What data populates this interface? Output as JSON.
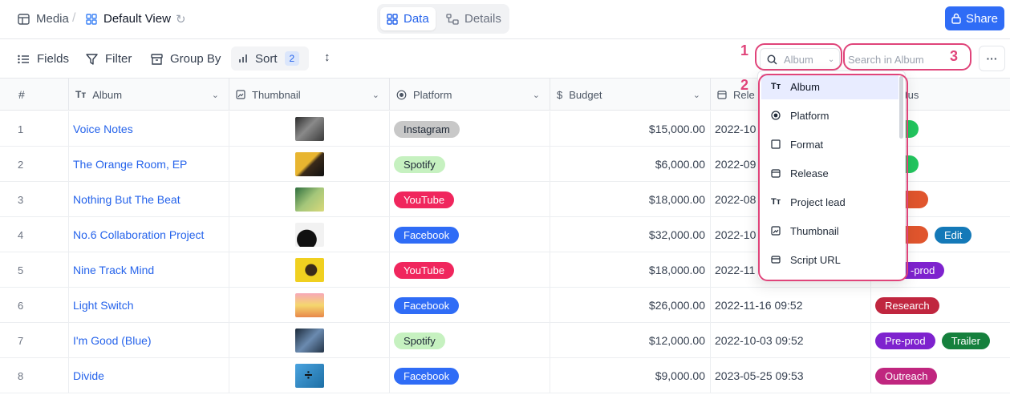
{
  "breadcrumb": {
    "base": "Media",
    "sep": "/",
    "view": "Default View"
  },
  "view_tabs": [
    {
      "label": "Data"
    },
    {
      "label": "Details"
    }
  ],
  "share_label": "Share",
  "toolbar": {
    "fields": "Fields",
    "filter": "Filter",
    "group_by": "Group By",
    "sort": "Sort",
    "sort_count": "2"
  },
  "search": {
    "field": "Album",
    "placeholder": "Search in Album"
  },
  "columns": {
    "num": "#",
    "album": "Album",
    "thumbnail": "Thumbnail",
    "platform": "Platform",
    "budget": "Budget",
    "release": "Rele",
    "status": "tus"
  },
  "dropdown": [
    "Album",
    "Platform",
    "Format",
    "Release",
    "Project lead",
    "Thumbnail",
    "Script URL"
  ],
  "annotations": [
    "1",
    "2",
    "3"
  ],
  "rows": [
    {
      "num": "1",
      "album": "Voice Notes",
      "platform": "Instagram",
      "budget": "$15,000.00",
      "release": "2022-10"
    },
    {
      "num": "2",
      "album": "The Orange Room, EP",
      "platform": "Spotify",
      "budget": "$6,000.00",
      "release": "2022-09"
    },
    {
      "num": "3",
      "album": "Nothing But The Beat",
      "platform": "YouTube",
      "budget": "$18,000.00",
      "release": "2022-08"
    },
    {
      "num": "4",
      "album": "No.6 Collaboration Project",
      "platform": "Facebook",
      "budget": "$32,000.00",
      "release": "2022-10",
      "status2": "Edit"
    },
    {
      "num": "5",
      "album": "Nine Track Mind",
      "platform": "YouTube",
      "budget": "$18,000.00",
      "release": "2022-11",
      "status1": "-prod"
    },
    {
      "num": "6",
      "album": "Light Switch",
      "platform": "Facebook",
      "budget": "$26,000.00",
      "release": "2022-11-16 09:52",
      "status1": "Research"
    },
    {
      "num": "7",
      "album": "I'm Good (Blue)",
      "platform": "Spotify",
      "budget": "$12,000.00",
      "release": "2022-10-03 09:52",
      "status1": "Pre-prod",
      "status2": "Trailer"
    },
    {
      "num": "8",
      "album": "Divide",
      "platform": "Facebook",
      "budget": "$9,000.00",
      "release": "2023-05-25 09:53",
      "status1": "Outreach"
    }
  ]
}
